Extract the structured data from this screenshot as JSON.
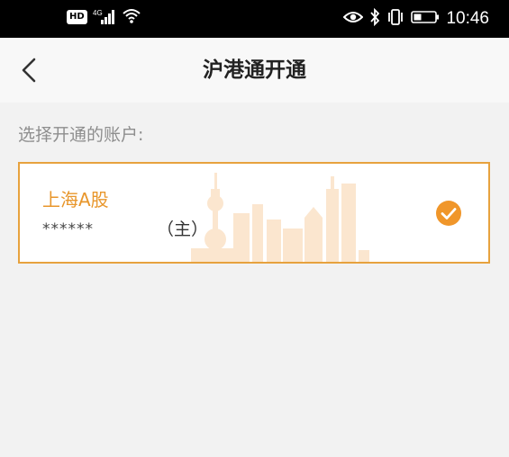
{
  "status_bar": {
    "network_badge": "HD",
    "network_type": "4G",
    "time": "10:46"
  },
  "header": {
    "title": "沪港通开通"
  },
  "main": {
    "section_label": "选择开通的账户:",
    "accounts": [
      {
        "name": "上海A股",
        "number": "******",
        "tag": "（主）",
        "selected": true
      }
    ]
  },
  "colors": {
    "accent": "#e7a23e",
    "check": "#f0962a",
    "background": "#f2f2f2"
  },
  "icons": [
    "back-arrow-icon",
    "eye-icon",
    "bluetooth-icon",
    "vibrate-icon",
    "battery-icon",
    "signal-icon",
    "wifi-icon",
    "check-circle-icon"
  ]
}
